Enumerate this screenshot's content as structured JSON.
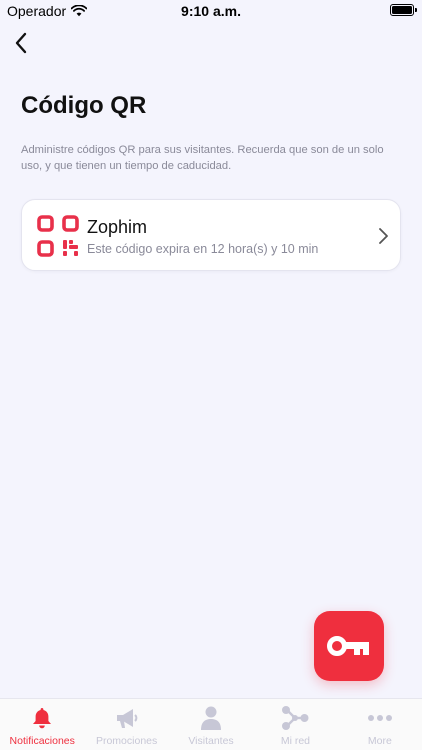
{
  "status_bar": {
    "carrier": "Operador",
    "time": "9:10 a.m."
  },
  "header": {
    "title": "Código QR",
    "description": "Administre códigos QR para sus visitantes. Recuerda que son de un solo uso, y que tienen un tiempo de caducidad."
  },
  "qr_list": [
    {
      "name": "Zophim",
      "expiry": "Este código expira en 12 hora(s) y 10 min"
    }
  ],
  "tabs": [
    {
      "label": "Notificaciones",
      "icon": "bell-icon",
      "active": true
    },
    {
      "label": "Promociones",
      "icon": "megaphone-icon",
      "active": false
    },
    {
      "label": "Visitantes",
      "icon": "person-icon",
      "active": false
    },
    {
      "label": "Mi red",
      "icon": "network-icon",
      "active": false
    },
    {
      "label": "More",
      "icon": "more-icon",
      "active": false
    }
  ],
  "colors": {
    "accent": "#ef2f3e",
    "background": "#f4f4fd",
    "inactive_tab": "#c7c7d6",
    "secondary_text": "#8a8a99"
  }
}
